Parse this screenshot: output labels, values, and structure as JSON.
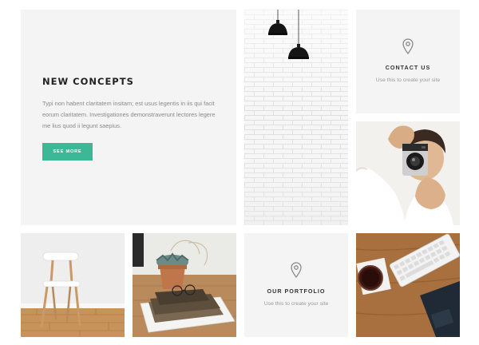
{
  "hero": {
    "title": "NEW CONCEPTS",
    "body": "Typi non habent claritatem insitam; est usus legentis in iis qui facit eorum claritatem. Investigationes demonstraverunt lectores legere me lius quod ii legunt saepius.",
    "button_label": "SEE MORE"
  },
  "contact": {
    "icon": "map-pin-icon",
    "title": "CONTACT US",
    "subtitle": "Use this to create your site"
  },
  "portfolio": {
    "icon": "map-pin-icon",
    "title": "OUR PORTFOLIO",
    "subtitle": "Use this to create your site"
  },
  "colors": {
    "accent": "#3cb896",
    "tile_background": "#f4f4f4",
    "heading": "#222222",
    "muted_text": "#8a8a8a"
  }
}
